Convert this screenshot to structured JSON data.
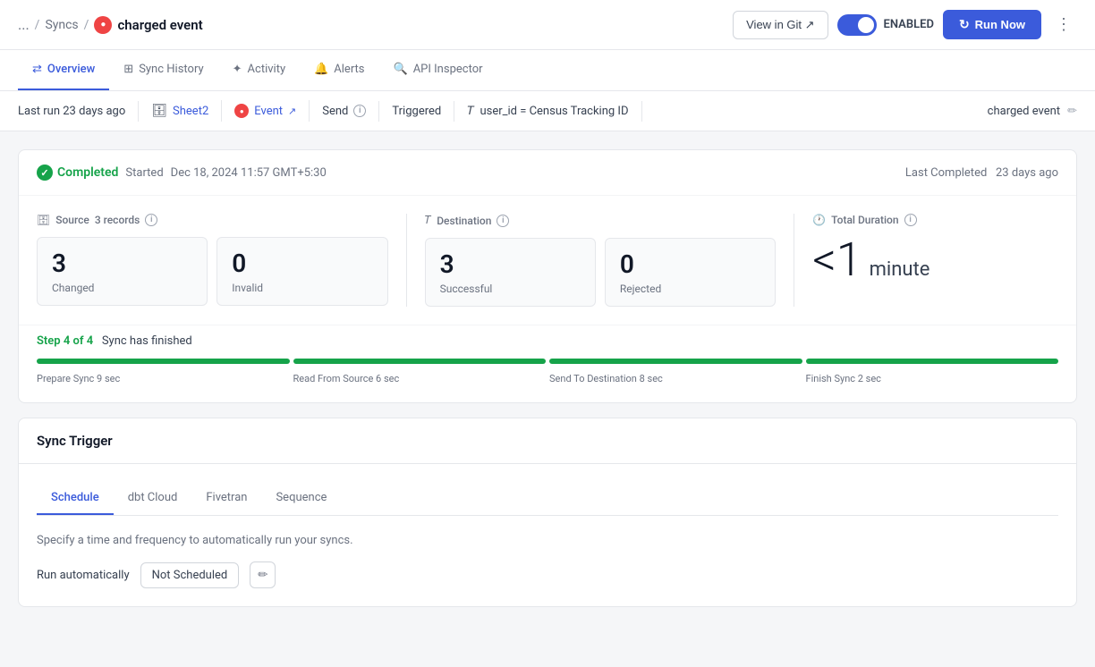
{
  "topbar": {
    "ellipsis": "...",
    "syncs_label": "Syncs",
    "separator": "/",
    "sync_name": "charged event",
    "view_git_label": "View in Git ↗",
    "toggle_label": "ENABLED",
    "run_now_label": "Run Now"
  },
  "nav": {
    "tabs": [
      {
        "id": "overview",
        "label": "Overview",
        "icon": "↔",
        "active": true
      },
      {
        "id": "sync-history",
        "label": "Sync History",
        "icon": "▦"
      },
      {
        "id": "activity",
        "label": "Activity",
        "icon": "✦"
      },
      {
        "id": "alerts",
        "label": "Alerts",
        "icon": "🔔"
      },
      {
        "id": "api-inspector",
        "label": "API Inspector",
        "icon": "🔍"
      }
    ]
  },
  "infobar": {
    "last_run": "Last run 23 days ago",
    "source_name": "Sheet2",
    "destination_name": "Event",
    "operation": "Send",
    "trigger": "Triggered",
    "mapping": "user_id = Census Tracking ID",
    "sync_name": "charged event"
  },
  "completed": {
    "badge": "Completed",
    "started_label": "Started",
    "started_date": "Dec 18, 2024 11:57 GMT+5:30",
    "last_completed_label": "Last Completed",
    "last_completed_ago": "23 days ago"
  },
  "source": {
    "title": "Source",
    "records_count": "3 records",
    "changed_value": "3",
    "changed_label": "Changed",
    "invalid_value": "0",
    "invalid_label": "Invalid"
  },
  "destination": {
    "title": "Destination",
    "successful_value": "3",
    "successful_label": "Successful",
    "rejected_value": "0",
    "rejected_label": "Rejected"
  },
  "duration": {
    "title": "Total Duration",
    "value": "<1",
    "unit": "minute"
  },
  "steps": {
    "step_indicator": "Step 4 of 4",
    "step_message": "Sync has finished",
    "bars": [
      {
        "label": "Prepare Sync 9 sec"
      },
      {
        "label": "Read From Source 6 sec"
      },
      {
        "label": "Send To Destination 8 sec"
      },
      {
        "label": "Finish Sync 2 sec"
      }
    ]
  },
  "sync_trigger": {
    "title": "Sync Trigger",
    "tabs": [
      {
        "id": "schedule",
        "label": "Schedule",
        "active": true
      },
      {
        "id": "dbt-cloud",
        "label": "dbt Cloud"
      },
      {
        "id": "fivetran",
        "label": "Fivetran"
      },
      {
        "id": "sequence",
        "label": "Sequence"
      }
    ],
    "description": "Specify a time and frequency to automatically run your syncs.",
    "run_auto_label": "Run automatically",
    "not_scheduled_label": "Not Scheduled"
  }
}
